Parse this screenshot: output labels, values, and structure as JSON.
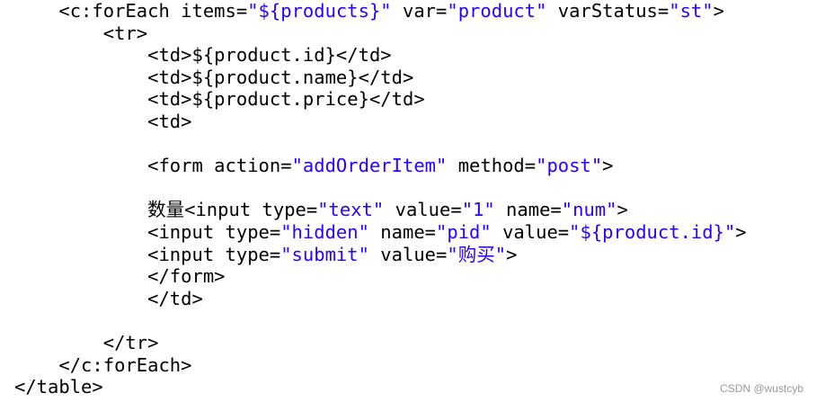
{
  "code": {
    "lines": [
      {
        "indent": "    ",
        "tokens": [
          {
            "t": "<c:forEach items=",
            "c": "p"
          },
          {
            "t": "\"${products}\"",
            "c": "s"
          },
          {
            "t": " var=",
            "c": "p"
          },
          {
            "t": "\"product\"",
            "c": "s"
          },
          {
            "t": " varStatus=",
            "c": "p"
          },
          {
            "t": "\"st\"",
            "c": "s"
          },
          {
            "t": ">",
            "c": "p"
          }
        ]
      },
      {
        "indent": "        ",
        "tokens": [
          {
            "t": "<tr>",
            "c": "p"
          }
        ]
      },
      {
        "indent": "            ",
        "tokens": [
          {
            "t": "<td>${product.id}</td>",
            "c": "p"
          }
        ]
      },
      {
        "indent": "            ",
        "tokens": [
          {
            "t": "<td>${product.name}</td>",
            "c": "p"
          }
        ]
      },
      {
        "indent": "            ",
        "tokens": [
          {
            "t": "<td>${product.price}</td>",
            "c": "p"
          }
        ]
      },
      {
        "indent": "            ",
        "tokens": [
          {
            "t": "<td>",
            "c": "p"
          }
        ]
      },
      {
        "indent": "",
        "tokens": []
      },
      {
        "indent": "            ",
        "tokens": [
          {
            "t": "<form action=",
            "c": "p"
          },
          {
            "t": "\"addOrderItem\"",
            "c": "s"
          },
          {
            "t": " method=",
            "c": "p"
          },
          {
            "t": "\"post\"",
            "c": "s"
          },
          {
            "t": ">",
            "c": "p"
          }
        ]
      },
      {
        "indent": "",
        "tokens": []
      },
      {
        "indent": "            ",
        "tokens": [
          {
            "t": "数量<input type=",
            "c": "p"
          },
          {
            "t": "\"text\"",
            "c": "s"
          },
          {
            "t": " value=",
            "c": "p"
          },
          {
            "t": "\"1\"",
            "c": "s"
          },
          {
            "t": " name=",
            "c": "p"
          },
          {
            "t": "\"num\"",
            "c": "s"
          },
          {
            "t": ">",
            "c": "p"
          }
        ]
      },
      {
        "indent": "            ",
        "tokens": [
          {
            "t": "<input type=",
            "c": "p"
          },
          {
            "t": "\"hidden\"",
            "c": "s"
          },
          {
            "t": " name=",
            "c": "p"
          },
          {
            "t": "\"pid\"",
            "c": "s"
          },
          {
            "t": " value=",
            "c": "p"
          },
          {
            "t": "\"${product.id}\"",
            "c": "s"
          },
          {
            "t": ">",
            "c": "p"
          }
        ]
      },
      {
        "indent": "            ",
        "tokens": [
          {
            "t": "<input type=",
            "c": "p"
          },
          {
            "t": "\"submit\"",
            "c": "s"
          },
          {
            "t": " value=",
            "c": "p"
          },
          {
            "t": "\"购买\"",
            "c": "s"
          },
          {
            "t": ">",
            "c": "p"
          }
        ]
      },
      {
        "indent": "            ",
        "tokens": [
          {
            "t": "</form>",
            "c": "p"
          }
        ]
      },
      {
        "indent": "            ",
        "tokens": [
          {
            "t": "</td>",
            "c": "p"
          }
        ]
      },
      {
        "indent": "",
        "tokens": []
      },
      {
        "indent": "        ",
        "tokens": [
          {
            "t": "</tr>",
            "c": "p"
          }
        ]
      },
      {
        "indent": "    ",
        "tokens": [
          {
            "t": "</c:forEach>",
            "c": "p"
          }
        ]
      },
      {
        "indent": "",
        "tokens": [
          {
            "t": "</table>",
            "c": "p"
          }
        ]
      }
    ]
  },
  "colors": {
    "plain": "#000000",
    "string": "#2a00ff",
    "background": "#ffffff",
    "watermark": "#999999"
  },
  "watermark": "CSDN @wustcyb"
}
